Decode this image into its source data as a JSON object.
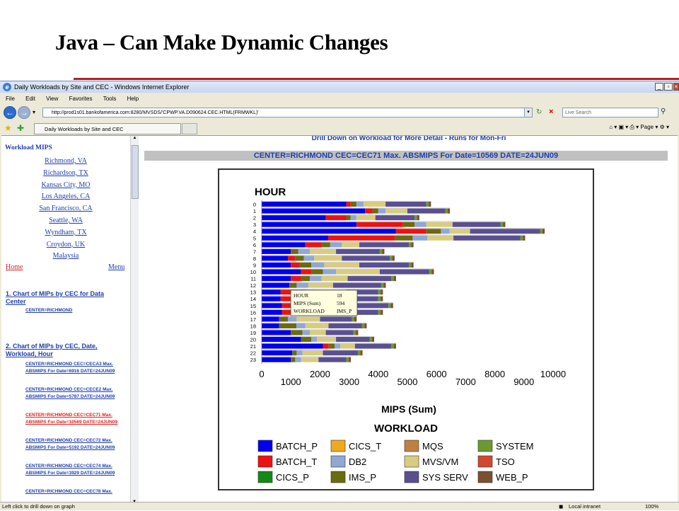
{
  "slide_title": "Java – Can Make Dynamic Changes",
  "window": {
    "title": "Daily Workloads by Site and CEC - Windows Internet Explorer",
    "menu": [
      "File",
      "Edit",
      "View",
      "Favorites",
      "Tools",
      "Help"
    ],
    "address": "http://prod1s01.bankofamerica.com:8280/MVSDS/'CPWP.VA.D090624.CEC.HTML(FRMWKL)'",
    "search_placeholder": "Live Search",
    "tab_label": "Daily Workloads by Site and CEC",
    "page_menu": "Page",
    "status_left": "Left click to drill down on graph",
    "status_zone": "Local intranet",
    "zoom": "100%"
  },
  "sidebar": {
    "heading": "Workload MIPS",
    "locations": [
      "Richmond, VA",
      "Richardson, TX",
      "Kansas City, MO",
      "Los Angeles, CA",
      "San Francisco, CA",
      "Seattle, WA",
      "Wyndham, TX",
      "Croydon, UK",
      "Malaysia"
    ],
    "home": "Home",
    "menu": "Menu",
    "section1": "1. Chart of MIPs by CEC for Data Center",
    "section1_link": "CENTER=RICHMOND",
    "section2": "2. Chart of MIPs by CEC, Date, Workload, Hour",
    "section2_links": [
      "CENTER=RICHMOND CEC=CECA3 Max. ABSMIPS For Date=6916 DATE=24JUN09",
      "CENTER=RICHMOND CEC=CECE2 Max. ABSMIPS For Date=5787 DATE=24JUN09",
      "CENTER=RICHMOND CEC=CEC71 Max. ABSMIPS For Date=10569 DATE=24JUN09",
      "CENTER=RICHMOND CEC=CEC72 Max. ABSMIPS For Date=5192 DATE=24JUN09",
      "CENTER=RICHMOND CEC=CEC74 Max. ABSMIPS For Date=3929 DATE=24JUN09",
      "CENTER=RICHMOND CEC=CEC78 Max."
    ]
  },
  "main": {
    "drill_text": "Drill Down on Workload for More Detail - Runs for Mon-Fri",
    "center_text": "CENTER=RICHMOND CEC=CEC71 Max. ABSMIPS For Date=10569 DATE=24JUN09"
  },
  "tooltip": {
    "rows": [
      [
        "HOUR",
        "18"
      ],
      [
        "MIPS (Sum)",
        "594"
      ],
      [
        "WORKLOAD",
        "IMS_P"
      ]
    ]
  },
  "chart_data": {
    "type": "bar",
    "orientation": "horizontal",
    "stacked": true,
    "ylabel": "HOUR",
    "xlabel": "MIPS (Sum)",
    "legend_title": "WORKLOAD",
    "xlim": [
      0,
      10000
    ],
    "xticks": [
      0,
      1000,
      2000,
      3000,
      4000,
      5000,
      6000,
      7000,
      8000,
      9000,
      10000
    ],
    "categories": [
      "0",
      "1",
      "2",
      "3",
      "4",
      "5",
      "6",
      "7",
      "8",
      "9",
      "10",
      "11",
      "12",
      "13",
      "14",
      "15",
      "16",
      "17",
      "18",
      "19",
      "20",
      "21",
      "22",
      "23"
    ],
    "series": [
      {
        "name": "BATCH_P",
        "color": "#0000ee",
        "values": [
          2900,
          3550,
          2200,
          3250,
          4600,
          2280,
          1500,
          1000,
          900,
          1000,
          1350,
          1000,
          950,
          650,
          650,
          700,
          700,
          600,
          600,
          1000,
          1350,
          2100,
          1050,
          1000
        ]
      },
      {
        "name": "BATCH_T",
        "color": "#ee1111",
        "values": [
          150,
          250,
          700,
          1600,
          1050,
          2300,
          550,
          0,
          250,
          300,
          350,
          350,
          0,
          600,
          600,
          500,
          600,
          0,
          0,
          0,
          0,
          200,
          0,
          0
        ]
      },
      {
        "name": "CICS_P",
        "color": "#138a13",
        "values": [
          0,
          0,
          0,
          0,
          0,
          0,
          0,
          0,
          0,
          0,
          0,
          0,
          0,
          0,
          0,
          0,
          0,
          0,
          0,
          0,
          0,
          0,
          0,
          0
        ]
      },
      {
        "name": "IMS_P",
        "color": "#6b6b10",
        "values": [
          200,
          200,
          150,
          400,
          500,
          600,
          300,
          250,
          300,
          400,
          400,
          300,
          250,
          300,
          300,
          350,
          300,
          300,
          594,
          400,
          350,
          200,
          150,
          150
        ]
      },
      {
        "name": "CICS_T",
        "color": "#f0a820",
        "values": [
          0,
          0,
          0,
          0,
          0,
          0,
          0,
          0,
          0,
          0,
          0,
          0,
          0,
          0,
          0,
          0,
          0,
          0,
          0,
          0,
          0,
          0,
          0,
          0
        ]
      },
      {
        "name": "DB2",
        "color": "#8fa8d4",
        "values": [
          250,
          250,
          200,
          400,
          300,
          500,
          400,
          400,
          350,
          450,
          450,
          400,
          400,
          400,
          400,
          400,
          350,
          300,
          300,
          250,
          200,
          200,
          200,
          200
        ]
      },
      {
        "name": "MVS/VM",
        "color": "#d8cc80",
        "values": [
          750,
          750,
          650,
          900,
          700,
          900,
          600,
          900,
          950,
          1200,
          1500,
          900,
          850,
          950,
          950,
          1050,
          950,
          800,
          800,
          550,
          650,
          500,
          700,
          600
        ]
      },
      {
        "name": "SYS SERV",
        "color": "#5a5090",
        "values": [
          1400,
          1300,
          1350,
          1650,
          2400,
          2300,
          1700,
          1500,
          1650,
          1700,
          1700,
          1500,
          1650,
          1100,
          1100,
          1350,
          1100,
          1100,
          1150,
          950,
          1150,
          1250,
          1200,
          950
        ]
      },
      {
        "name": "MQS",
        "color": "#c08040",
        "values": [
          0,
          0,
          0,
          0,
          0,
          0,
          0,
          0,
          0,
          0,
          0,
          0,
          0,
          0,
          0,
          0,
          0,
          0,
          0,
          0,
          0,
          0,
          0,
          0
        ]
      },
      {
        "name": "TSO",
        "color": "#d04830",
        "values": [
          0,
          0,
          0,
          0,
          0,
          0,
          0,
          0,
          0,
          0,
          0,
          0,
          0,
          0,
          0,
          0,
          0,
          0,
          0,
          0,
          0,
          0,
          0,
          0
        ]
      },
      {
        "name": "SYSTEM",
        "color": "#6a9a30",
        "values": [
          80,
          80,
          80,
          80,
          80,
          80,
          80,
          80,
          80,
          80,
          80,
          80,
          80,
          80,
          80,
          80,
          80,
          80,
          80,
          80,
          80,
          80,
          80,
          80
        ]
      },
      {
        "name": "WEB_P",
        "color": "#7a5030",
        "values": [
          80,
          80,
          80,
          80,
          80,
          80,
          80,
          80,
          80,
          80,
          80,
          80,
          80,
          80,
          80,
          80,
          80,
          80,
          80,
          80,
          80,
          80,
          80,
          80
        ]
      }
    ],
    "legend_order": [
      "BATCH_P",
      "CICS_T",
      "MQS",
      "SYSTEM",
      "BATCH_T",
      "DB2",
      "MVS/VM",
      "TSO",
      "CICS_P",
      "IMS_P",
      "SYS SERV",
      "WEB_P"
    ]
  }
}
